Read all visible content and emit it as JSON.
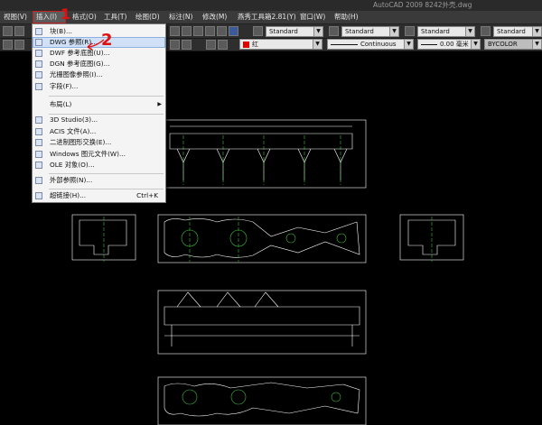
{
  "window": {
    "title": "AutoCAD 2009  8242外壳.dwg"
  },
  "menubar": [
    "视图(V)",
    "插入(I)",
    "格式(O)",
    "工具(T)",
    "绘图(D)",
    "标注(N)",
    "修改(M)",
    "燕秀工具箱2.81(Y)",
    "窗口(W)",
    "帮助(H)"
  ],
  "toolbar": {
    "text_style": "Standard",
    "dim_style": "Standard",
    "table_style": "Standard",
    "ml_style": "Standard",
    "color": "红",
    "linetype": "Continuous",
    "lineweight": "0.00 毫米",
    "plotstyle": "BYCOLOR"
  },
  "insert_menu": [
    {
      "label": "块(B)...",
      "shortcut": ""
    },
    {
      "label": "DWG 参照(R)...",
      "shortcut": "",
      "highlighted": true
    },
    {
      "label": "DWF 参考底图(U)...",
      "shortcut": ""
    },
    {
      "label": "DGN 参考底图(G)...",
      "shortcut": ""
    },
    {
      "label": "光栅图像参照(I)...",
      "shortcut": ""
    },
    {
      "label": "字段(F)...",
      "shortcut": ""
    },
    {
      "label": "布局(L)",
      "shortcut": "",
      "submenu": true
    },
    {
      "label": "3D Studio(3)...",
      "shortcut": ""
    },
    {
      "label": "ACIS 文件(A)...",
      "shortcut": ""
    },
    {
      "label": "二进制图形交换(E)...",
      "shortcut": ""
    },
    {
      "label": "Windows 图元文件(W)...",
      "shortcut": ""
    },
    {
      "label": "OLE 对象(O)...",
      "shortcut": ""
    },
    {
      "label": "外部参照(N)...",
      "shortcut": ""
    },
    {
      "label": "超链接(H)...",
      "shortcut": "Ctrl+K"
    }
  ],
  "annotations": {
    "step1": "1",
    "step2": "2"
  },
  "colors": {
    "menubar": "#3a3a3a",
    "drawing_line": "#ffffff",
    "detail_green": "#3fbf3f",
    "annotation_red": "#e01010"
  }
}
